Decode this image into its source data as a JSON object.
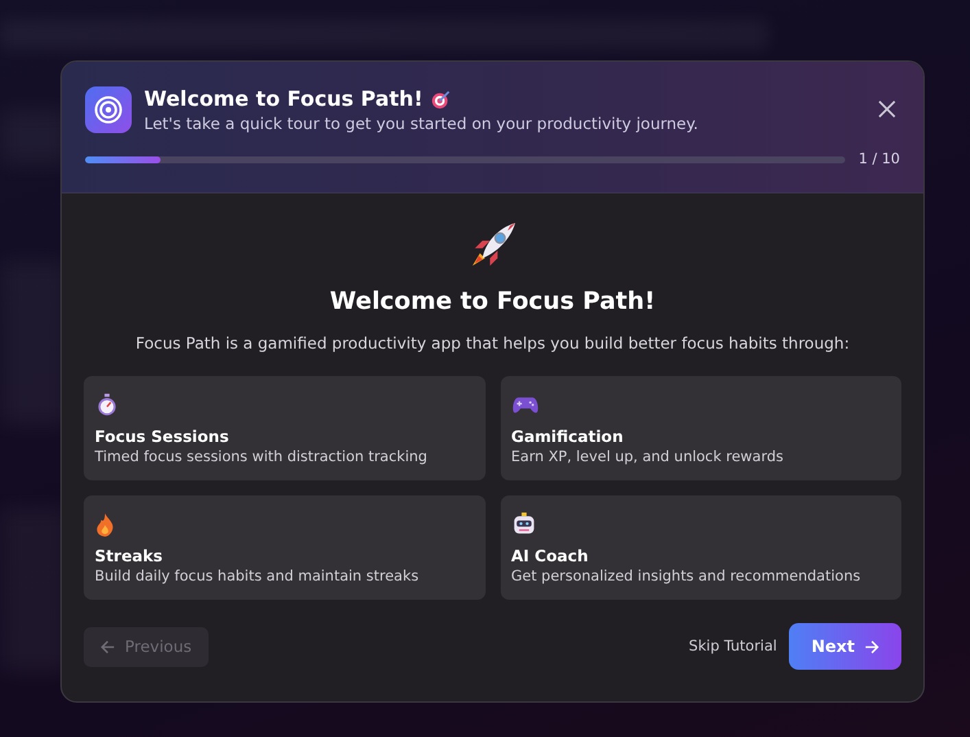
{
  "dialog": {
    "title": "Welcome to Focus Path!",
    "subtitle": "Let's take a quick tour to get you started on your productivity journey.",
    "progress": {
      "level": 0.1,
      "reading": "1 / 10"
    }
  },
  "step": {
    "heading": "Welcome to Focus Path!",
    "description": "Focus Path is a gamified productivity app that helps you build better focus habits through:",
    "features": [
      {
        "kind": "stopwatch",
        "title": "Focus Sessions",
        "text": "Timed focus sessions with distraction tracking"
      },
      {
        "kind": "gamepad",
        "title": "Gamification",
        "text": "Earn XP, level up, and unlock rewards"
      },
      {
        "kind": "flame",
        "title": "Streaks",
        "text": "Build daily focus habits and maintain streaks"
      },
      {
        "kind": "robot",
        "title": "AI Coach",
        "text": "Get personalized insights and recommendations"
      }
    ]
  },
  "footer": {
    "previous": {
      "label": "Previous",
      "disabled": true
    },
    "skip": "Skip Tutorial",
    "next": {
      "label": "Next",
      "disabled": false
    }
  }
}
